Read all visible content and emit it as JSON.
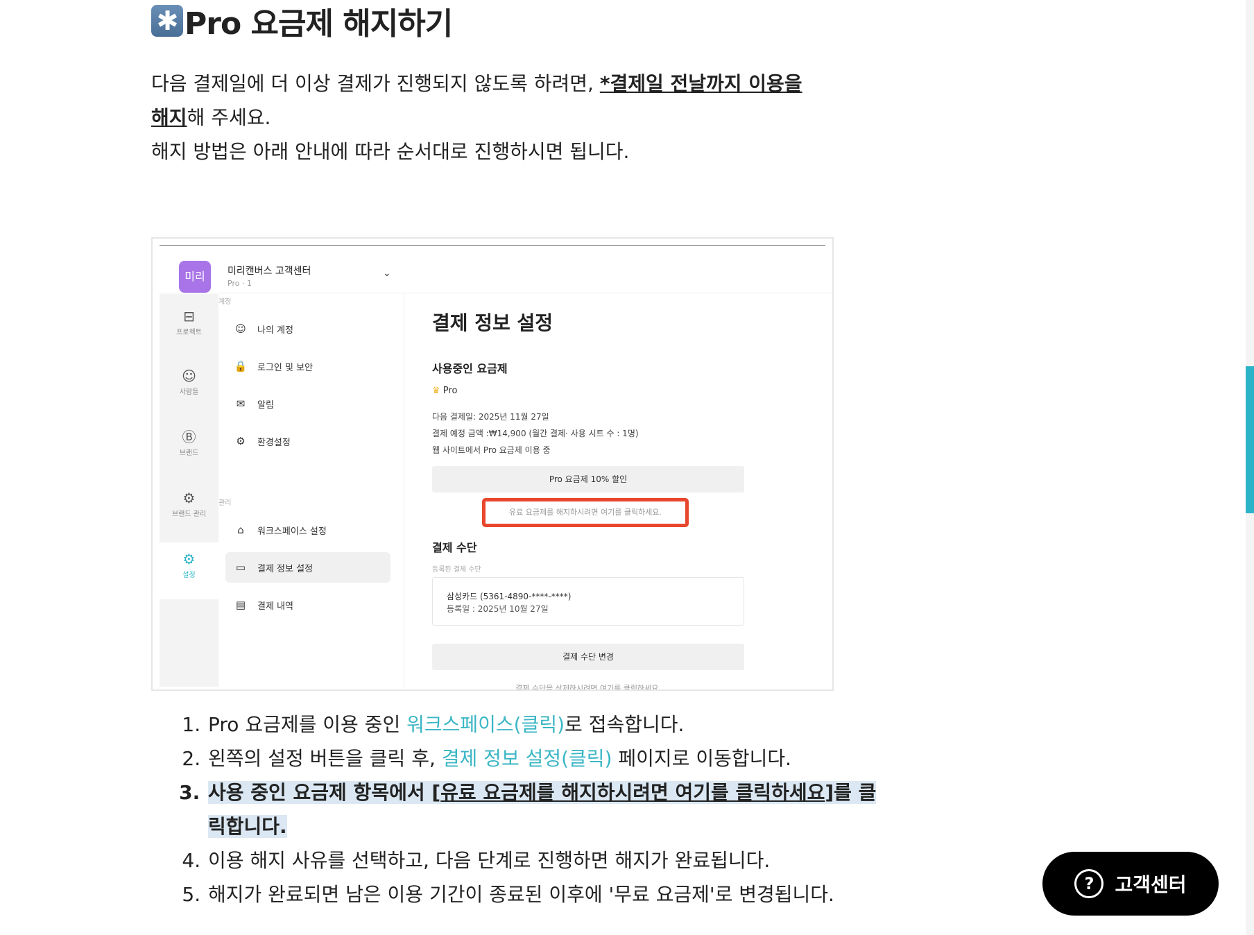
{
  "heading": {
    "icon": "asterisk-icon",
    "icon_glyph": "✱",
    "text": "Pro 요금제 해지하기"
  },
  "intro": {
    "p1_before": "다음 결제일에 더 이상 결제가 진행되지 않도록 하려면, ",
    "p1_bold": "*결제일 전날까지 이용을",
    "p2_bold": "해지",
    "p2_after": "해 주세요.",
    "p3": "해지 방법은 아래 안내에 따라 순서대로 진행하시면 됩니다."
  },
  "screenshot": {
    "logo": "미리",
    "workspace_name": "미리캔버스 고객센터",
    "workspace_sub": "Pro · 1",
    "rail": [
      {
        "label": "프로젝트",
        "icon": "archive-icon",
        "glyph": "⊟"
      },
      {
        "label": "사람들",
        "icon": "people-icon",
        "glyph": "☺"
      },
      {
        "label": "브랜드",
        "icon": "brand-icon",
        "glyph": "Ⓑ"
      },
      {
        "label": "브랜드 관리",
        "icon": "brand-manage-icon",
        "glyph": "⚙"
      },
      {
        "label": "설정",
        "icon": "settings-icon",
        "glyph": "⚙"
      }
    ],
    "section_account": "계정",
    "section_manage": "관리",
    "menu": [
      {
        "label": "나의 계정",
        "glyph": "☺"
      },
      {
        "label": "로그인 및 보안",
        "glyph": "🔒"
      },
      {
        "label": "알림",
        "glyph": "✉"
      },
      {
        "label": "환경설정",
        "glyph": "⚙"
      },
      {
        "label": "워크스페이스 설정",
        "glyph": "⌂"
      },
      {
        "label": "결제 정보 설정",
        "glyph": "▭"
      },
      {
        "label": "결제 내역",
        "glyph": "▤"
      }
    ],
    "main_title": "결제 정보 설정",
    "plan_section": "사용중인 요금제",
    "plan_name": "Pro",
    "next_payment": "다음 결제일: 2025년 11월 27일",
    "amount": "결제 예정 금액 :₩14,900 (월간 결제· 사용 시트 수 : 1명)",
    "web_note": "웹 사이트에서 Pro 요금제 이용 중",
    "discount_button": "Pro 요금제 10% 할인",
    "cancel_link": "유료 요금제를 해지하시려면 여기를 클릭하세요.",
    "payment_section": "결제 수단",
    "registered_label": "등록된 결제 수단",
    "card": "삼성카드 (5361-4890-****-****)",
    "card_date": "등록일 : 2025년 10월 27일",
    "change_button": "결제 수단 변경",
    "cut_text": "결제 수단을 삭제하시려면 여기를 클릭하세요."
  },
  "steps": {
    "s1_before": "Pro 요금제를 이용 중인 ",
    "s1_link": "워크스페이스(클릭)",
    "s1_after": "로 접속합니다.",
    "s2_before": "왼쪽의 설정 버튼을 클릭 후, ",
    "s2_link": "결제 정보 설정(클릭)",
    "s2_after": " 페이지로 이동합니다.",
    "s3_before": "사용 중인 요금제 항목에서 [",
    "s3_underlined": "유료 요금제를 해지하시려면 여기를 클릭하세요",
    "s3_after": "]를 클릭합니다.",
    "s4": "이용 해지 사유를 선택하고, 다음 단계로 진행하면 해지가 완료됩니다.",
    "s5": "해지가 완료되면 남은 이용 기간이 종료된 이후에 '무료 요금제'로 변경됩니다."
  },
  "help_button": {
    "label": "고객센터",
    "icon": "question-icon",
    "glyph": "?"
  },
  "colors": {
    "link": "#3bb6c5",
    "highlight": "#dbe8f3",
    "cancel_border": "#e8472d",
    "logo": "#a874e8"
  }
}
